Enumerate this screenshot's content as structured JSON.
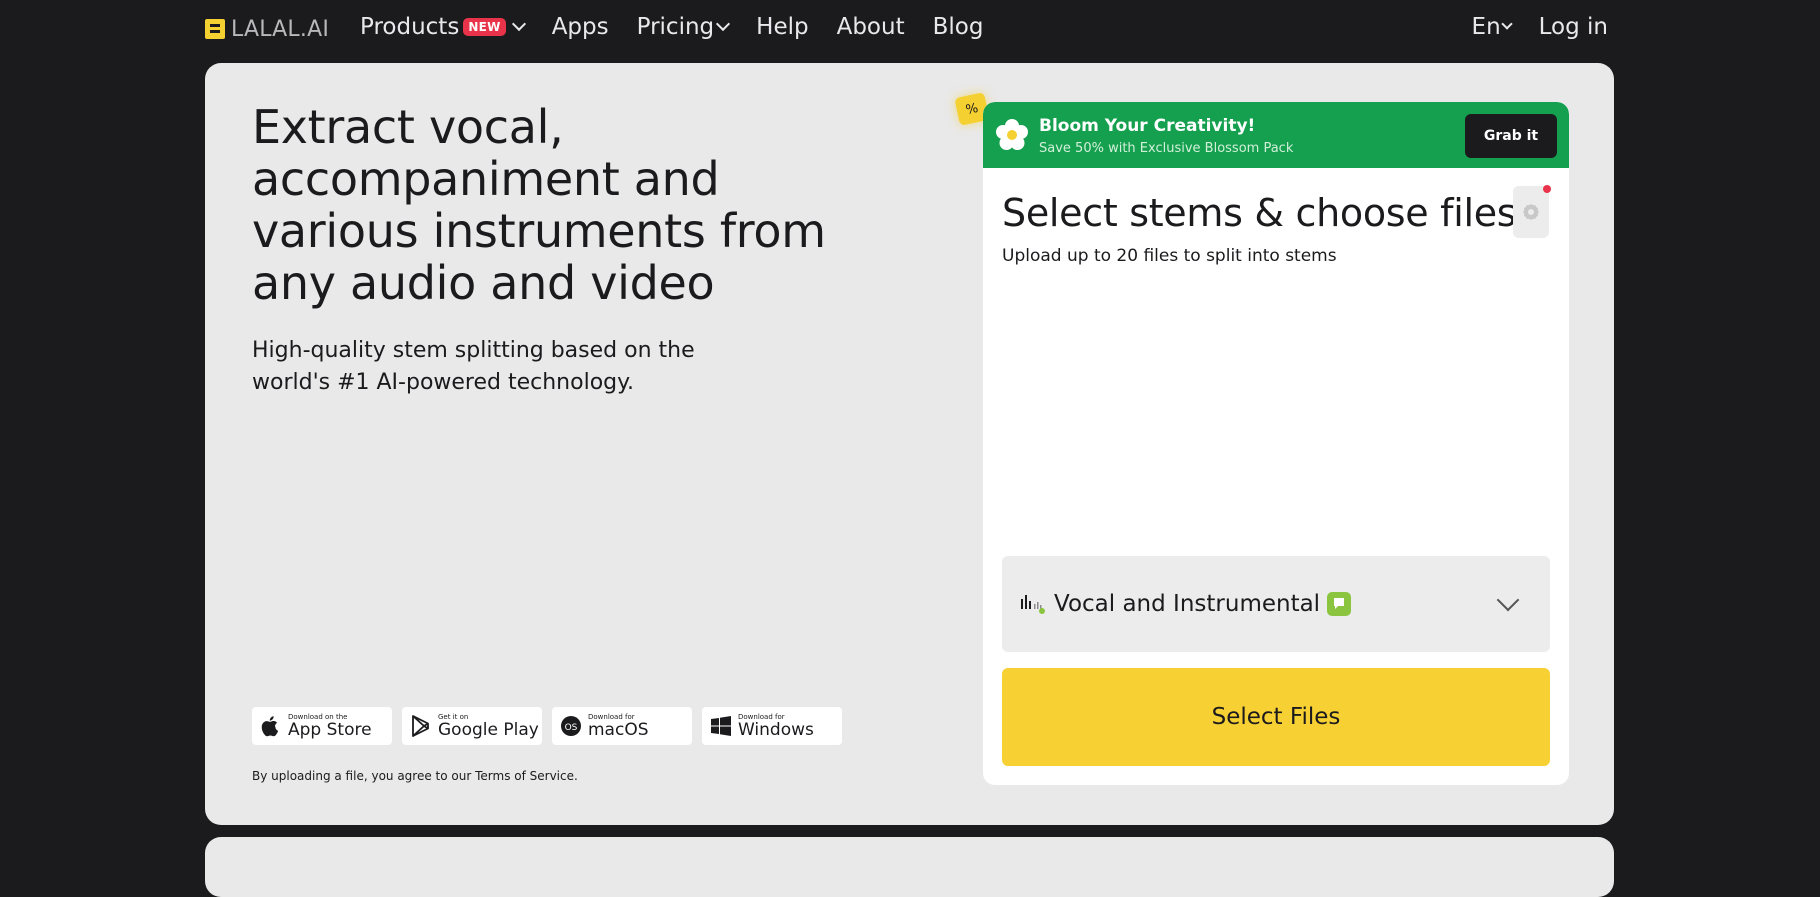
{
  "nav": {
    "logo_text": "LALAL.AI",
    "items": [
      {
        "label": "Products",
        "badge": "NEW",
        "dropdown": true
      },
      {
        "label": "Apps"
      },
      {
        "label": "Pricing",
        "dropdown": true
      },
      {
        "label": "Help"
      },
      {
        "label": "About"
      },
      {
        "label": "Blog"
      }
    ],
    "language": "En",
    "login": "Log in"
  },
  "hero": {
    "headline": "Extract vocal, accompaniment and various instruments from any audio and video",
    "subline": "High-quality stem splitting based on the world's #1 AI-powered technology.",
    "stores": [
      {
        "small": "Download on the",
        "big": "App Store",
        "icon": "apple-icon"
      },
      {
        "small": "Get it on",
        "big": "Google Play",
        "icon": "google-play-icon"
      },
      {
        "small": "Download for",
        "big": "macOS",
        "icon": "macos-icon"
      },
      {
        "small": "Download for",
        "big": "Windows",
        "icon": "windows-icon"
      }
    ],
    "terms": "By uploading a file, you agree to our Terms of Service."
  },
  "promo": {
    "tag": "%",
    "title": "Bloom Your Creativity!",
    "subtitle": "Save 50% with Exclusive Blossom Pack",
    "button": "Grab it"
  },
  "upload": {
    "title": "Select stems & choose files",
    "subtitle": "Upload up to 20 files to split into stems",
    "stem_option": "Vocal and Instrumental",
    "select_button": "Select Files"
  },
  "colors": {
    "background": "#1b1a1d",
    "accent_yellow": "#f7d133",
    "promo_green": "#15a04f",
    "badge_red": "#e8334a"
  }
}
